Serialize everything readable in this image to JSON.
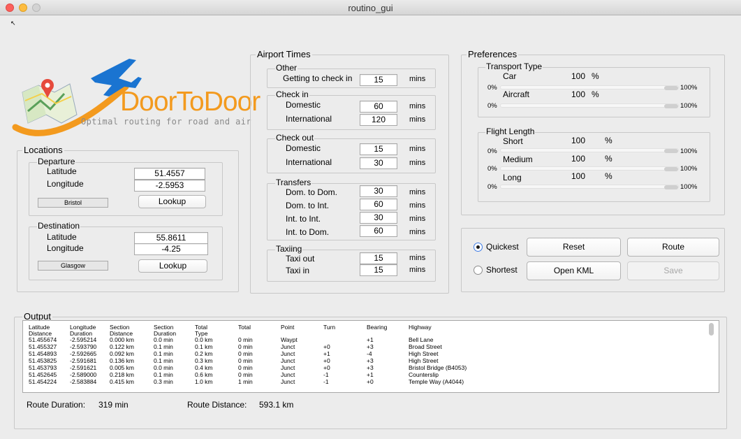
{
  "window": {
    "title": "routino_gui",
    "toolbar_icon": "↖"
  },
  "logo": {
    "name": "DoorToDoor",
    "tagline": "Optimal routing for road and air"
  },
  "locations": {
    "title": "Locations",
    "departure": {
      "title": "Departure",
      "lat_label": "Latitude",
      "lon_label": "Longitude",
      "lat": "51.4557",
      "lon": "-2.5953",
      "city": "Bristol",
      "lookup": "Lookup"
    },
    "destination": {
      "title": "Destination",
      "lat_label": "Latitude",
      "lon_label": "Longitude",
      "lat": "55.8611",
      "lon": "-4.25",
      "city": "Glasgow",
      "lookup": "Lookup"
    }
  },
  "airport": {
    "title": "Airport Times",
    "unit": "mins",
    "other": {
      "title": "Other",
      "rows": [
        {
          "label": "Getting to check in",
          "value": "15"
        }
      ]
    },
    "checkin": {
      "title": "Check in",
      "rows": [
        {
          "label": "Domestic",
          "value": "60"
        },
        {
          "label": "International",
          "value": "120"
        }
      ]
    },
    "checkout": {
      "title": "Check out",
      "rows": [
        {
          "label": "Domestic",
          "value": "15"
        },
        {
          "label": "International",
          "value": "30"
        }
      ]
    },
    "transfers": {
      "title": "Transfers",
      "rows": [
        {
          "label": "Dom. to Dom.",
          "value": "30"
        },
        {
          "label": "Dom. to Int.",
          "value": "60"
        },
        {
          "label": "Int. to Int.",
          "value": "30"
        },
        {
          "label": "Int. to Dom.",
          "value": "60"
        }
      ]
    },
    "taxiing": {
      "title": "Taxiing",
      "rows": [
        {
          "label": "Taxi out",
          "value": "15"
        },
        {
          "label": "Taxi in",
          "value": "15"
        }
      ]
    }
  },
  "preferences": {
    "title": "Preferences",
    "transport": {
      "title": "Transport Type",
      "items": [
        {
          "label": "Car",
          "value": "100",
          "unit": "%",
          "min": "0%",
          "max": "100%",
          "level": 1.0
        },
        {
          "label": "Aircraft",
          "value": "100",
          "unit": "%",
          "min": "0%",
          "max": "100%",
          "level": 1.0
        }
      ]
    },
    "flight": {
      "title": "Flight Length",
      "items": [
        {
          "label": "Short",
          "value": "100",
          "unit": "%",
          "min": "0%",
          "max": "100%",
          "level": 1.0
        },
        {
          "label": "Medium",
          "value": "100",
          "unit": "%",
          "min": "0%",
          "max": "100%",
          "level": 1.0
        },
        {
          "label": "Long",
          "value": "100",
          "unit": "%",
          "min": "0%",
          "max": "100%",
          "level": 1.0
        }
      ]
    }
  },
  "controls": {
    "quickest": "Quickest",
    "shortest": "Shortest",
    "selected": "Quickest",
    "reset": "Reset",
    "route": "Route",
    "open_kml": "Open KML",
    "save": "Save"
  },
  "output": {
    "title": "Output",
    "headers1": [
      "Latitude",
      "Longitude",
      "Section",
      "Section",
      "Total",
      "Total",
      "Point",
      "Turn",
      "Bearing",
      "Highway"
    ],
    "headers2": [
      "Distance",
      "Duration",
      "Distance",
      "Duration",
      "Type",
      "",
      "",
      "",
      "",
      ""
    ],
    "rows": [
      [
        "51.455674",
        "-2.595214",
        "0.000 km",
        "0.0 min",
        "0.0 km",
        "0 min",
        "Waypt",
        "",
        "+1",
        "Bell Lane"
      ],
      [
        "51.455327",
        "-2.593790",
        "0.122 km",
        "0.1 min",
        "0.1 km",
        "0 min",
        "Junct",
        "+0",
        "+3",
        "Broad Street"
      ],
      [
        "51.454893",
        "-2.592665",
        "0.092 km",
        "0.1 min",
        "0.2 km",
        "0 min",
        "Junct",
        "+1",
        "-4",
        "High Street"
      ],
      [
        "51.453825",
        "-2.591681",
        "0.136 km",
        "0.1 min",
        "0.3 km",
        "0 min",
        "Junct",
        "+0",
        "+3",
        "High Street"
      ],
      [
        "51.453793",
        "-2.591621",
        "0.005 km",
        "0.0 min",
        "0.4 km",
        "0 min",
        "Junct",
        "+0",
        "+3",
        "Bristol Bridge (B4053)"
      ],
      [
        "51.452645",
        "-2.589000",
        "0.218 km",
        "0.1 min",
        "0.6 km",
        "0 min",
        "Junct",
        "-1",
        "+1",
        "Counterslip"
      ],
      [
        "51.454224",
        "-2.583884",
        "0.415 km",
        "0.3 min",
        "1.0 km",
        "1 min",
        "Junct",
        "-1",
        "+0",
        "Temple Way (A4044)"
      ]
    ],
    "route_duration_label": "Route Duration:",
    "route_duration": "319 min",
    "route_distance_label": "Route Distance:",
    "route_distance": "593.1 km"
  },
  "colors": {
    "logo_blue": "#1f6fc0",
    "logo_orange": "#f39a1e",
    "plane_blue": "#1a74d1"
  }
}
